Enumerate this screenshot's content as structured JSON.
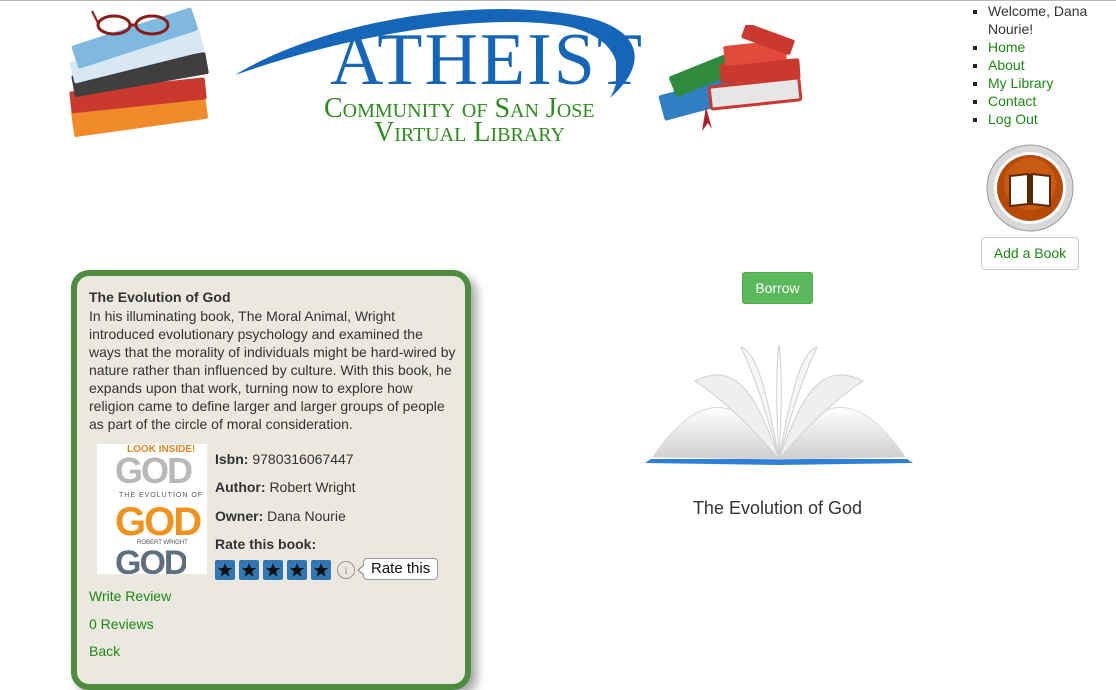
{
  "header": {
    "logo_main": "ATHEIST",
    "logo_line1": "Community of San Jose",
    "logo_line2": "Virtual Library"
  },
  "nav": {
    "welcome": "Welcome, Dana Nourie!",
    "items": [
      "Home",
      "About",
      "My Library",
      "Contact",
      "Log Out"
    ]
  },
  "add_book_label": "Add a Book",
  "book": {
    "title": "The Evolution of God",
    "description": "In his illuminating book, The Moral Animal, Wright introduced evolutionary psychology and examined the ways that the morality of individuals might be hard-wired by nature rather than influenced by culture. With this book, he expands upon that work, turning now to explore how religion came to define larger and larger groups of people as part of the circle of moral consideration.",
    "isbn_label": "Isbn:",
    "isbn": "9780316067447",
    "author_label": "Author:",
    "author": "Robert Wright",
    "owner_label": "Owner:",
    "owner": "Dana Nourie",
    "rate_label": "Rate this book:",
    "rating_stars": 5,
    "rate_tooltip": "Rate this",
    "cover_badge": "LOOK INSIDE!",
    "cover_subtitle": "THE EVOLUTION OF",
    "cover_word": "GOD",
    "cover_author": "ROBERT WRIGHT"
  },
  "links": {
    "write_review": "Write Review",
    "reviews": "0 Reviews",
    "back": "Back"
  },
  "borrow_label": "Borrow",
  "caption": "The Evolution of God",
  "colors": {
    "link": "#1a8a12",
    "card_border": "#4f8c3f",
    "card_bg": "#ebe8df",
    "borrow": "#5cb85c",
    "logo_blue": "#1565b8",
    "logo_green": "#2e8b1e",
    "star_button": "#2f77b5"
  }
}
